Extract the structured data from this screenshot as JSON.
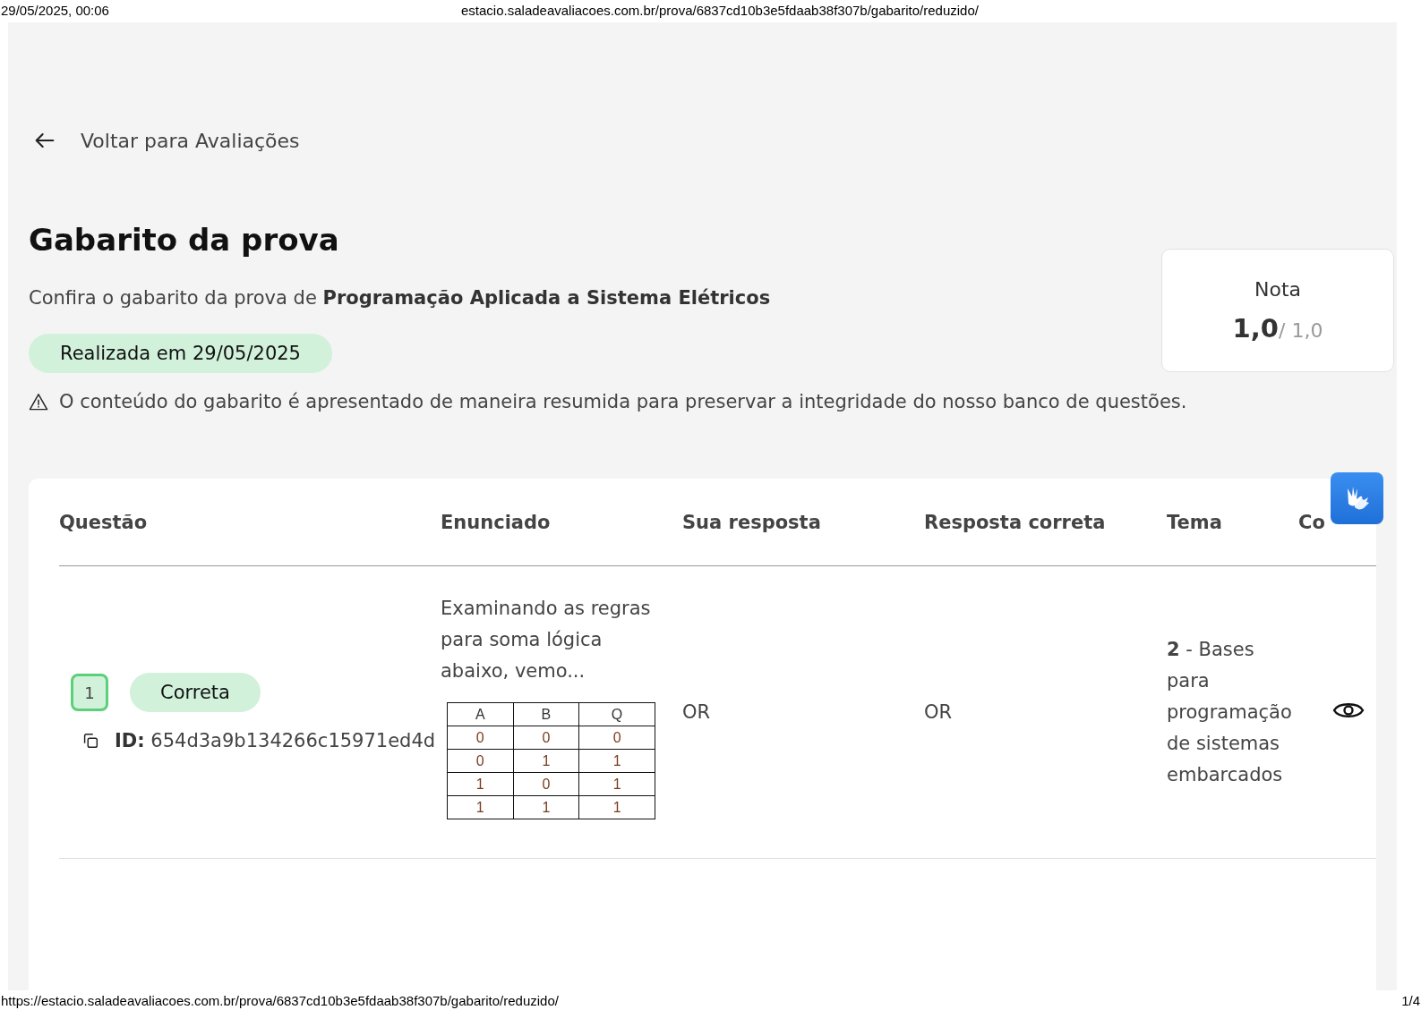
{
  "print_header": {
    "date": "29/05/2025, 00:06",
    "url": "estacio.saladeavaliacoes.com.br/prova/6837cd10b3e5fdaab38f307b/gabarito/reduzido/"
  },
  "back_link": {
    "label": "Voltar para Avaliações"
  },
  "title": "Gabarito da prova",
  "subtitle": "Confira o gabarito da prova de **Programação Aplicada a Sistema Elétricos**",
  "date_badge": "Realizada em 29/05/2025",
  "notice": "O conteúdo do gabarito é apresentado de maneira resumida para preservar a integridade do nosso banco de questões.",
  "grade": {
    "label": "Nota",
    "value": "1,0",
    "max": "/ 1,0"
  },
  "table": {
    "columns": [
      "Questão",
      "Enunciado",
      "Sua resposta",
      "Resposta correta",
      "Tema",
      "Co"
    ],
    "rows": [
      {
        "number": "1",
        "correct": true,
        "status": "Correta",
        "id_label": "ID:",
        "id": "654d3a9b134266c15971ed4d",
        "statement": "Examinando as regras para soma lógica abaixo, vemo...",
        "truth_table": [
          [
            "A",
            "B",
            "Q"
          ],
          [
            "0",
            "0",
            "0"
          ],
          [
            "0",
            "1",
            "1"
          ],
          [
            "1",
            "0",
            "1"
          ],
          [
            "1",
            "1",
            "1"
          ]
        ],
        "your_answer": "OR",
        "correct_answer": "OR",
        "theme": "**2** - Bases para programação de sistemas embarcados"
      }
    ]
  },
  "print_footer": {
    "url": "https://estacio.saladeavaliacoes.com.br/prova/6837cd10b3e5fdaab38f307b/gabarito/reduzido/",
    "page": "1/4"
  }
}
